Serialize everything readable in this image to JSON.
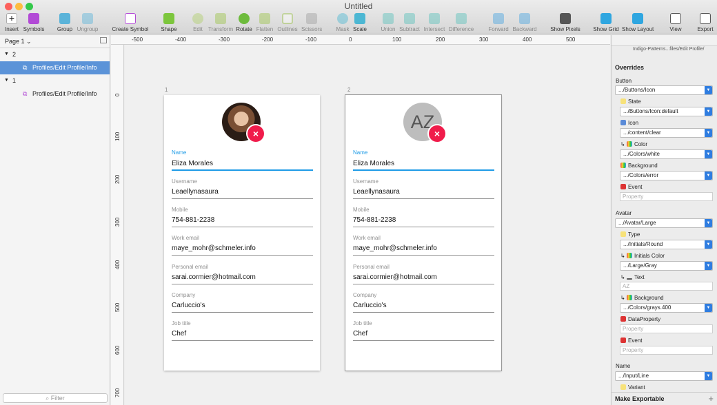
{
  "window": {
    "title": "Untitled"
  },
  "toolbar": {
    "insert": "Insert",
    "symbols": "Symbols",
    "group": "Group",
    "ungroup": "Ungroup",
    "create_symbol": "Create Symbol",
    "shape": "Shape",
    "edit": "Edit",
    "transform": "Transform",
    "rotate": "Rotate",
    "flatten": "Flatten",
    "outlines": "Outlines",
    "scissors": "Scissors",
    "mask": "Mask",
    "scale": "Scale",
    "union": "Union",
    "subtract": "Subtract",
    "intersect": "Intersect",
    "difference": "Difference",
    "forward": "Forward",
    "backward": "Backward",
    "show_pixels": "Show Pixels",
    "show_grid": "Show Grid",
    "show_layout": "Show Layout",
    "view": "View",
    "export": "Export"
  },
  "layers": {
    "page": "Page 1",
    "g2": "2",
    "g2_item": "Profiles/Edit Profile/Info",
    "g1": "1",
    "g1_item": "Profiles/Edit Profile/Info",
    "filter_placeholder": "Filter"
  },
  "ruler": {
    "h": [
      "-500",
      "-400",
      "-300",
      "-200",
      "-100",
      "0",
      "100",
      "200",
      "300",
      "400",
      "500"
    ],
    "v": [
      "0",
      "100",
      "200",
      "300",
      "400",
      "500",
      "600",
      "700"
    ]
  },
  "artboards": [
    {
      "number": "1",
      "fields": [
        {
          "label": "Name",
          "value": "Eliza Morales"
        },
        {
          "label": "Username",
          "value": "Leaellynasaura"
        },
        {
          "label": "Mobile",
          "value": "754-881-2238"
        },
        {
          "label": "Work email",
          "value": "maye_mohr@schmeler.info"
        },
        {
          "label": "Personal email",
          "value": "sarai.cormier@hotmail.com"
        },
        {
          "label": "Company",
          "value": "Carluccio's"
        },
        {
          "label": "Job title",
          "value": "Chef"
        }
      ]
    },
    {
      "number": "2",
      "initials": "AZ",
      "fields": [
        {
          "label": "Name",
          "value": "Eliza Morales"
        },
        {
          "label": "Username",
          "value": "Leaellynasaura"
        },
        {
          "label": "Mobile",
          "value": "754-881-2238"
        },
        {
          "label": "Work email",
          "value": "maye_mohr@schmeler.info"
        },
        {
          "label": "Personal email",
          "value": "sarai.cormier@hotmail.com"
        },
        {
          "label": "Company",
          "value": "Carluccio's"
        },
        {
          "label": "Job title",
          "value": "Chef"
        }
      ]
    }
  ],
  "inspector": {
    "top_path": "Indigo-Patterns...files/Edit Profile/",
    "overrides": "Overrides",
    "button": {
      "title": "Button",
      "value": ".../Buttons/Icon",
      "state": "State",
      "state_value": ".../Buttons/Icon:default",
      "icon": "Icon",
      "icon_value": ".../content/clear",
      "color": "Color",
      "color_value": ".../Colors/white",
      "background": "Background",
      "background_value": ".../Colors/error",
      "event": "Event",
      "event_ph": "Property"
    },
    "avatar": {
      "title": "Avatar",
      "value": ".../Avatar/Large",
      "type": "Type",
      "type_value": ".../Initials/Round",
      "initials_color": "Initials Color",
      "initials_color_value": ".../Large/Gray",
      "text": "Text",
      "text_ph": "AZ",
      "background": "Background",
      "background_value": ".../Colors/grays.400",
      "data_property": "DataProperty",
      "data_ph": "Property",
      "event": "Event",
      "event_ph": "Property"
    },
    "name": {
      "title": "Name",
      "value": ".../Input/Line",
      "variant": "Variant"
    },
    "export": "Make Exportable"
  },
  "colors": {
    "accent": "#1e9be6",
    "error": "#f01c4b",
    "selection": "#5b93d8"
  }
}
